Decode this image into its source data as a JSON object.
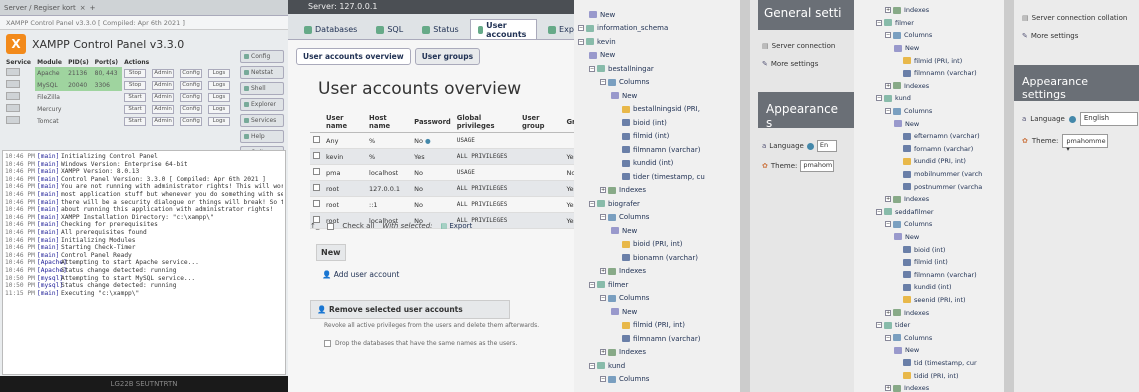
{
  "panel1": {
    "browser_tab": "Server / Regiser kort",
    "window_title": "XAMPP Control Panel v3.3.0   [ Compiled: Apr 6th 2021 ]",
    "title": "XAMPP Control Panel v3.3.0",
    "logo_text": "X",
    "right_buttons": [
      "Config",
      "Netstat",
      "Shell",
      "Explorer",
      "Services",
      "Help",
      "Quit"
    ],
    "headers": [
      "Service",
      "Module",
      "PID(s)",
      "Port(s)",
      "Actions"
    ],
    "modules": [
      {
        "name": "Apache",
        "pid": "21136",
        "port": "80, 443",
        "action": "Stop",
        "running": true
      },
      {
        "name": "MySQL",
        "pid": "20040",
        "port": "3306",
        "action": "Stop",
        "running": true
      },
      {
        "name": "FileZilla",
        "pid": "",
        "port": "",
        "action": "Start",
        "running": false
      },
      {
        "name": "Mercury",
        "pid": "",
        "port": "",
        "action": "Start",
        "running": false
      },
      {
        "name": "Tomcat",
        "pid": "",
        "port": "",
        "action": "Start",
        "running": false
      }
    ],
    "row_buttons": [
      "Admin",
      "Config",
      "Logs"
    ],
    "log": [
      {
        "t": "10:46 PM",
        "m": "[main]",
        "msg": "Initializing Control Panel"
      },
      {
        "t": "10:46 PM",
        "m": "[main]",
        "msg": "Windows Version:  Enterprise  64-bit"
      },
      {
        "t": "10:46 PM",
        "m": "[main]",
        "msg": "XAMPP Version: 8.0.13"
      },
      {
        "t": "10:46 PM",
        "m": "[main]",
        "msg": "Control Panel Version: 3.3.0  [ Compiled: Apr 6th 2021 ]"
      },
      {
        "t": "10:46 PM",
        "m": "[main]",
        "msg": "You are not running with administrator rights! This will work for"
      },
      {
        "t": "10:46 PM",
        "m": "[main]",
        "msg": "most application stuff but whenever you do something with services"
      },
      {
        "t": "10:46 PM",
        "m": "[main]",
        "msg": "there will be a security dialogue or things will break! So think"
      },
      {
        "t": "10:46 PM",
        "m": "[main]",
        "msg": "about running this application with administrator rights!"
      },
      {
        "t": "10:46 PM",
        "m": "[main]",
        "msg": "XAMPP Installation Directory: \"c:\\xampp\\\""
      },
      {
        "t": "10:46 PM",
        "m": "[main]",
        "msg": "Checking for prerequisites"
      },
      {
        "t": "10:46 PM",
        "m": "[main]",
        "msg": "All prerequisites found"
      },
      {
        "t": "10:46 PM",
        "m": "[main]",
        "msg": "Initializing Modules"
      },
      {
        "t": "10:46 PM",
        "m": "[main]",
        "msg": "Starting Check-Timer"
      },
      {
        "t": "10:46 PM",
        "m": "[main]",
        "msg": "Control Panel Ready"
      },
      {
        "t": "10:46 PM",
        "m": "[Apache]",
        "msg": "Attempting to start Apache service..."
      },
      {
        "t": "10:46 PM",
        "m": "[Apache]",
        "msg": "Status change detected: running"
      },
      {
        "t": "10:50 PM",
        "m": "[mysql]",
        "msg": "Attempting to start MySQL service..."
      },
      {
        "t": "10:50 PM",
        "m": "[mysql]",
        "msg": "Status change detected: running"
      },
      {
        "t": "11:15 PM",
        "m": "[main]",
        "msg": "Executing \"c:\\xampp\\\""
      }
    ],
    "footer": "LG22B SEUTNTRTN"
  },
  "panel2": {
    "server": "Server: 127.0.0.1",
    "tabs": [
      "Databases",
      "SQL",
      "Status",
      "User accounts",
      "Export"
    ],
    "active_tab": "User accounts",
    "subtabs": [
      "User accounts overview",
      "User groups"
    ],
    "heading": "User accounts overview",
    "columns": [
      "User name",
      "Host name",
      "Password",
      "Global privileges",
      "User group",
      "Gr"
    ],
    "users": [
      {
        "user": "Any",
        "host": "%",
        "password": "No",
        "privileges": "USAGE",
        "grant": "",
        "user_red": true
      },
      {
        "user": "kevin",
        "host": "%",
        "password": "Yes",
        "privileges": "ALL PRIVILEGES",
        "grant": "Yes",
        "user_red": false
      },
      {
        "user": "pma",
        "host": "localhost",
        "password": "No",
        "privileges": "USAGE",
        "grant": "No",
        "user_red": false
      },
      {
        "user": "root",
        "host": "127.0.0.1",
        "password": "No",
        "privileges": "ALL PRIVILEGES",
        "grant": "Yes",
        "user_red": false
      },
      {
        "user": "root",
        "host": "::1",
        "password": "No",
        "privileges": "ALL PRIVILEGES",
        "grant": "Yes",
        "user_red": false
      },
      {
        "user": "root",
        "host": "localhost",
        "password": "No",
        "privileges": "ALL PRIVILEGES",
        "grant": "Yes",
        "user_red": false
      }
    ],
    "check_all": "Check all",
    "with_selected": "With selected:",
    "export": "Export",
    "new_label": "New",
    "add_user": "Add user account",
    "remove_label": "Remove selected user accounts",
    "remove_desc": "Revoke all active privileges from the users and delete them afterwards.",
    "drop_label": "Drop the databases that have the same names as the users."
  },
  "panel3": {
    "tree": [
      {
        "d": 1,
        "t": "New",
        "i": "new"
      },
      {
        "d": 0,
        "t": "information_schema",
        "i": "db"
      },
      {
        "d": 0,
        "t": "kevin",
        "i": "db"
      },
      {
        "d": 1,
        "t": "New",
        "i": "new"
      },
      {
        "d": 1,
        "t": "bestallningar",
        "i": "db"
      },
      {
        "d": 2,
        "t": "Columns",
        "i": "col"
      },
      {
        "d": 3,
        "t": "New",
        "i": "new"
      },
      {
        "d": 4,
        "t": "bestallningsid (PRI,",
        "i": "key"
      },
      {
        "d": 4,
        "t": "bioid (int)",
        "i": "field"
      },
      {
        "d": 4,
        "t": "filmid (int)",
        "i": "field"
      },
      {
        "d": 4,
        "t": "filmnamn (varchar)",
        "i": "field"
      },
      {
        "d": 4,
        "t": "kundid (int)",
        "i": "field"
      },
      {
        "d": 4,
        "t": "tider (timestamp, cu",
        "i": "field"
      },
      {
        "d": 2,
        "t": "Indexes",
        "i": "idx"
      },
      {
        "d": 1,
        "t": "biografer",
        "i": "db"
      },
      {
        "d": 2,
        "t": "Columns",
        "i": "col"
      },
      {
        "d": 3,
        "t": "New",
        "i": "new"
      },
      {
        "d": 4,
        "t": "bioid (PRI, int)",
        "i": "key"
      },
      {
        "d": 4,
        "t": "bionamn (varchar)",
        "i": "field"
      },
      {
        "d": 2,
        "t": "Indexes",
        "i": "idx"
      },
      {
        "d": 1,
        "t": "filmer",
        "i": "db"
      },
      {
        "d": 2,
        "t": "Columns",
        "i": "col"
      },
      {
        "d": 3,
        "t": "New",
        "i": "new"
      },
      {
        "d": 4,
        "t": "filmid (PRI, int)",
        "i": "key"
      },
      {
        "d": 4,
        "t": "filmnamn (varchar)",
        "i": "field"
      },
      {
        "d": 2,
        "t": "Indexes",
        "i": "idx"
      },
      {
        "d": 1,
        "t": "kund",
        "i": "db"
      },
      {
        "d": 2,
        "t": "Columns",
        "i": "col"
      }
    ],
    "general_title": "General setti",
    "server_conn": "Server connection",
    "more_settings": "More settings",
    "appearance_title": "Appearance s",
    "language_label": "Language",
    "language_value": "En",
    "theme_label": "Theme:",
    "theme_value": "pmahom"
  },
  "panel4": {
    "tree": [
      {
        "d": 3,
        "t": "Indexes",
        "i": "idx"
      },
      {
        "d": 2,
        "t": "filmer",
        "i": "db"
      },
      {
        "d": 3,
        "t": "Columns",
        "i": "col"
      },
      {
        "d": 4,
        "t": "New",
        "i": "new"
      },
      {
        "d": 5,
        "t": "filmid (PRI, int)",
        "i": "key"
      },
      {
        "d": 5,
        "t": "filmnamn (varchar)",
        "i": "field"
      },
      {
        "d": 3,
        "t": "Indexes",
        "i": "idx"
      },
      {
        "d": 2,
        "t": "kund",
        "i": "db"
      },
      {
        "d": 3,
        "t": "Columns",
        "i": "col"
      },
      {
        "d": 4,
        "t": "New",
        "i": "new"
      },
      {
        "d": 5,
        "t": "efternamn (varchar)",
        "i": "field"
      },
      {
        "d": 5,
        "t": "fornamn (varchar)",
        "i": "field"
      },
      {
        "d": 5,
        "t": "kundid (PRI, int)",
        "i": "key"
      },
      {
        "d": 5,
        "t": "mobilnummer (varch",
        "i": "field"
      },
      {
        "d": 5,
        "t": "postnummer (varcha",
        "i": "field"
      },
      {
        "d": 3,
        "t": "Indexes",
        "i": "idx"
      },
      {
        "d": 2,
        "t": "seddafilmer",
        "i": "db"
      },
      {
        "d": 3,
        "t": "Columns",
        "i": "col"
      },
      {
        "d": 4,
        "t": "New",
        "i": "new"
      },
      {
        "d": 5,
        "t": "bioid (int)",
        "i": "field"
      },
      {
        "d": 5,
        "t": "filmid (int)",
        "i": "field"
      },
      {
        "d": 5,
        "t": "filmnamn (varchar)",
        "i": "field"
      },
      {
        "d": 5,
        "t": "kundid (int)",
        "i": "field"
      },
      {
        "d": 5,
        "t": "seenid (PRI, int)",
        "i": "key"
      },
      {
        "d": 3,
        "t": "Indexes",
        "i": "idx"
      },
      {
        "d": 2,
        "t": "tider",
        "i": "db"
      },
      {
        "d": 3,
        "t": "Columns",
        "i": "col"
      },
      {
        "d": 4,
        "t": "New",
        "i": "new"
      },
      {
        "d": 5,
        "t": "tid (timestamp, cur",
        "i": "field"
      },
      {
        "d": 5,
        "t": "tidid (PRI, int)",
        "i": "key"
      },
      {
        "d": 3,
        "t": "Indexes",
        "i": "idx"
      }
    ],
    "server_conn_collation": "Server connection collation",
    "more_settings": "More settings",
    "appearance_title": "Appearance settings",
    "language_label": "Language",
    "language_value": "English",
    "theme_label": "Theme:",
    "theme_value": "pmahomme"
  }
}
